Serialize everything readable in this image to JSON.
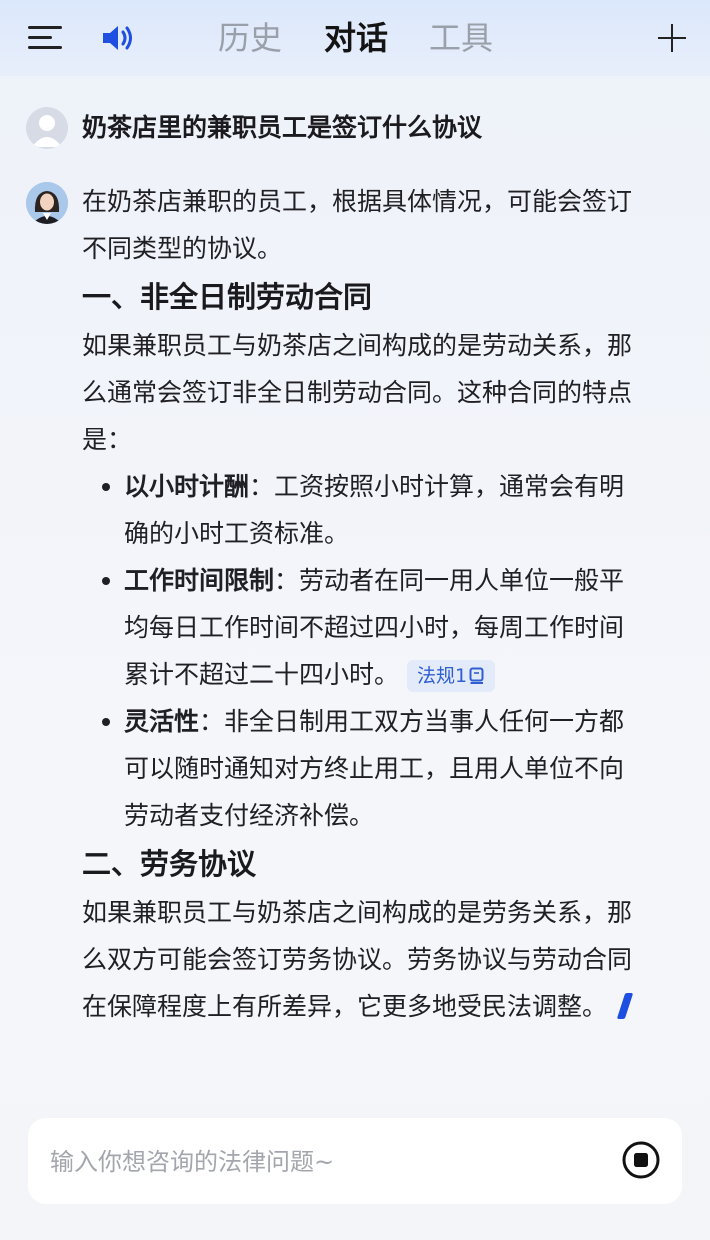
{
  "header": {
    "tabs": [
      {
        "label": "历史",
        "active": false
      },
      {
        "label": "对话",
        "active": true
      },
      {
        "label": "工具",
        "active": false
      }
    ],
    "icons": {
      "menu": "menu-icon",
      "speaker": "speaker-icon",
      "new": "plus-icon"
    },
    "accent_color": "#1e4fe0"
  },
  "chat": {
    "question": "奶茶店里的兼职员工是签订什么协议",
    "answer": {
      "intro": [
        "在奶茶店兼职的员工，根据具体情况，可能会签订",
        "不同类型的协议。"
      ],
      "section1": {
        "heading": "一、非全日制劳动合同",
        "para": [
          "如果兼职员工与奶茶店之间构成的是劳动关系，那",
          "么通常会签订非全日制劳动合同。这种合同的特点",
          "是："
        ],
        "bullets": [
          {
            "term": "以小时计酬",
            "lines": [
              "：工资按照小时计算，通常会有明",
              "确的小时工资标准。"
            ]
          },
          {
            "term": "工作时间限制",
            "lines": [
              "：劳动者在同一用人单位一般平",
              "均每日工作时间不超过四小时，每周工作时间",
              "累计不超过二十四小时。"
            ],
            "tag": "法规1"
          },
          {
            "term": "灵活性",
            "lines": [
              "：非全日制用工双方当事人任何一方都",
              "可以随时通知对方终止用工，且用人单位不向",
              "劳动者支付经济补偿。"
            ]
          }
        ]
      },
      "section2": {
        "heading": "二、劳务协议",
        "para": [
          "如果兼职员工与奶茶店之间构成的是劳务关系，那",
          "么双方可能会签订劳务协议。劳务协议与劳动合同",
          "在保障程度上有所差异，它更多地受民法调整。"
        ]
      }
    }
  },
  "input": {
    "placeholder": "输入你想咨询的法律问题~",
    "value": ""
  }
}
